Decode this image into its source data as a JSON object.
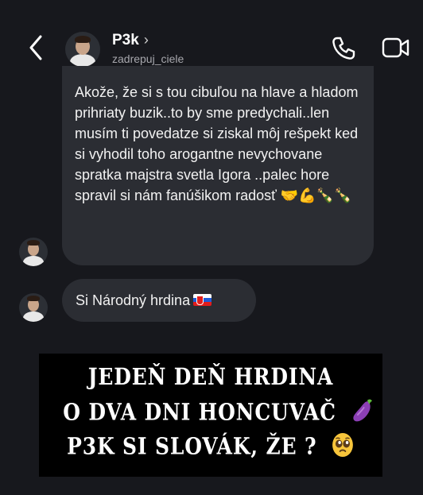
{
  "header": {
    "name": "P3k",
    "chevron": "›",
    "username": "zadrepuj_ciele",
    "icons": [
      "chevron-left-icon",
      "phone-icon",
      "video-camera-icon"
    ]
  },
  "messages": [
    {
      "text": "Akože, že si s tou cibuľou na hlave a hladom prihriaty buzik..to by sme predychali..len musím ti povedatze si ziskal môj rešpekt ked si vyhodil toho arogantne nevychovane spratka majstra svetla Igora ..palec hore spravil si nám fanúšikom radosť 🤝💪🍾🍾"
    },
    {
      "text": "Si Národný hrdina"
    }
  ],
  "banner": {
    "line1": "JEDEŇ DEŇ HRDINA",
    "line2": "O DVA DNI HONCUVAČ",
    "line3": "P3K SI SLOVÁK, ŽE ?",
    "emoji2": "eggplant-emoji",
    "emoji3": "pleading-face-emoji"
  },
  "colors": {
    "background": "#17181d",
    "bubble": "#2b2d33",
    "banner": "#000000",
    "text": "#f2f2f2",
    "muted": "#a7a7ad"
  }
}
